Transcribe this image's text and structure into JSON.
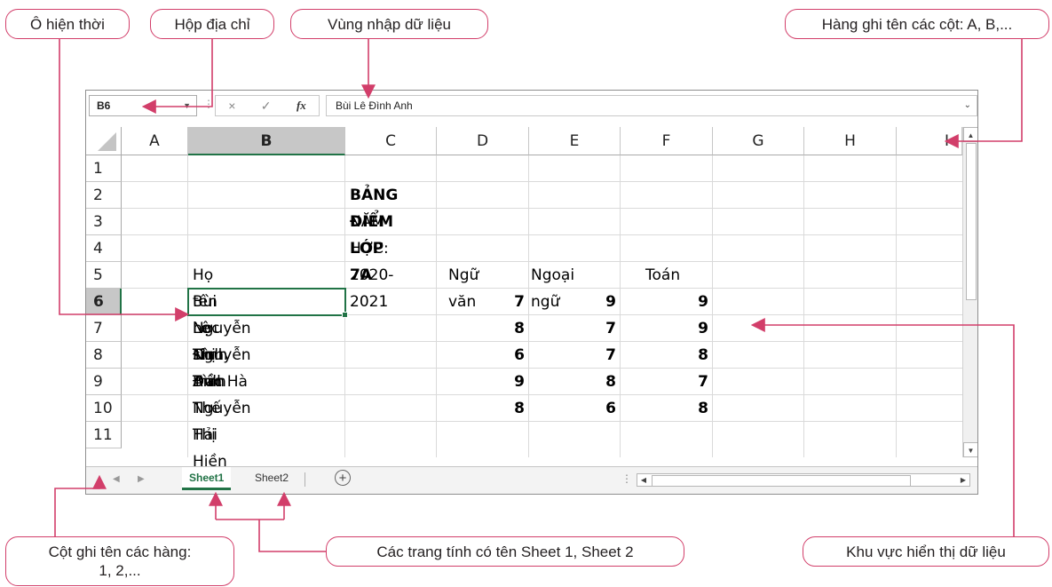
{
  "callouts": {
    "active_cell": "Ô hiện thời",
    "name_box": "Hộp địa chỉ",
    "formula_bar": "Vùng nhập dữ liệu",
    "column_headers": "Hàng ghi tên các cột: A, B,...",
    "row_headers_1": "Cột ghi tên các hàng:",
    "row_headers_2": "1, 2,...",
    "sheet_tabs": "Các trang tính có tên Sheet 1, Sheet 2",
    "data_area": "Khu vực hiển thị dữ liệu"
  },
  "toolbar": {
    "name_box": "B6",
    "cancel_icon": "×",
    "enter_icon": "✓",
    "fx_label": "fx",
    "formula_value": "Bùi Lê Đình Anh"
  },
  "columns": [
    "A",
    "B",
    "C",
    "D",
    "E",
    "F",
    "G",
    "H",
    "I"
  ],
  "rows": [
    "1",
    "2",
    "3",
    "4",
    "5",
    "6",
    "7",
    "8",
    "9",
    "10",
    "11"
  ],
  "sheet": {
    "title": "BẢNG ĐIỂM LỚP 7A",
    "school_year": "NĂM HỌC: 2020-2021",
    "header_name": "Họ tên học sinh",
    "header_literature": "Ngữ văn",
    "header_foreign": "Ngoại ngữ",
    "header_math": "Toán",
    "students": [
      {
        "name": "Bùi Lê Đình Anh",
        "literature": "7",
        "foreign": "9",
        "math": "9"
      },
      {
        "name": "Nguyễn Thị Bình",
        "literature": "8",
        "foreign": "7",
        "math": "9"
      },
      {
        "name": "Nguyễn Đức Hà",
        "literature": "6",
        "foreign": "7",
        "math": "8"
      },
      {
        "name": "Trần Thế Hải",
        "literature": "9",
        "foreign": "8",
        "math": "7"
      },
      {
        "name": "Nguyễn Thị Hiền",
        "literature": "8",
        "foreign": "6",
        "math": "8"
      }
    ]
  },
  "tabs": [
    "Sheet1",
    "Sheet2"
  ],
  "accent_color": "#217346",
  "callout_border_color": "#d23e6a"
}
